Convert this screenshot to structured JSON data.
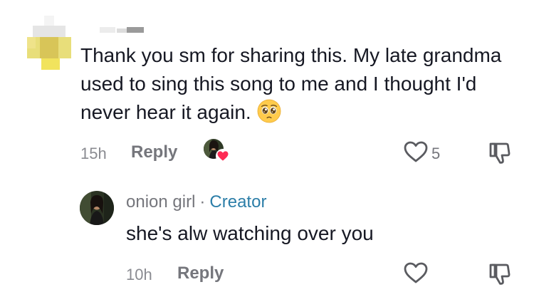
{
  "comment": {
    "text": "Thank you sm for sharing this. My late grandma used to sing this song to me and I thought I'd never hear it again.",
    "emoji_icon": "pleading-face-emoji",
    "time": "15h",
    "reply_label": "Reply",
    "like_count": "5"
  },
  "reply_comment": {
    "username": "onion girl",
    "separator": "·",
    "badge": "Creator",
    "text": "she's alw watching over you",
    "time": "10h",
    "reply_label": "Reply"
  },
  "colors": {
    "text_primary": "#161823",
    "text_secondary": "#8a8b91",
    "creator_blue": "#2c7ea8",
    "heart_pink": "#fe2c55"
  }
}
